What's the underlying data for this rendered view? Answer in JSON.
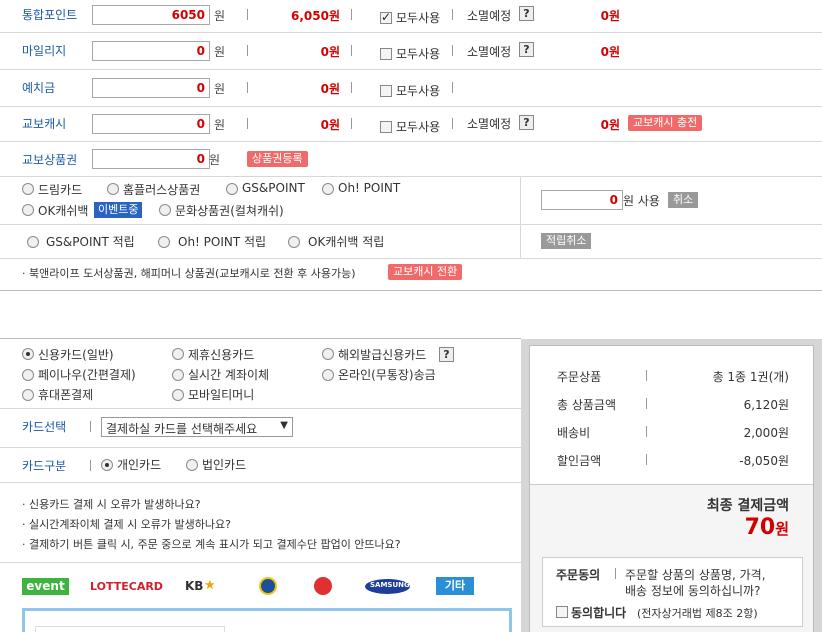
{
  "points": {
    "integrated": {
      "label": "통합포인트",
      "input": "6050",
      "won": "원",
      "available": "6,050원",
      "use_all": "모두사용",
      "use_all_checked": true,
      "expiry_label": "소멸예정",
      "expiry_value": "0원"
    },
    "mileage": {
      "label": "마일리지",
      "input": "0",
      "won": "원",
      "available": "0원",
      "use_all": "모두사용",
      "use_all_checked": false,
      "expiry_label": "소멸예정",
      "expiry_value": "0원"
    },
    "deposit": {
      "label": "예치금",
      "input": "0",
      "won": "원",
      "available": "0원",
      "use_all": "모두사용",
      "use_all_checked": false
    },
    "kyobo_cash": {
      "label": "교보캐시",
      "input": "0",
      "won": "원",
      "available": "0원",
      "use_all": "모두사용",
      "use_all_checked": false,
      "expiry_label": "소멸예정",
      "expiry_value": "0원",
      "charge_btn": "교보캐시 충전"
    },
    "gift_cert": {
      "label": "교보상품권",
      "input": "0",
      "won": "원",
      "register_btn": "상품권등록"
    }
  },
  "other_points": {
    "options": [
      "드림카드",
      "홈플러스상품권",
      "GS&POINT",
      "Oh! POINT",
      "OK캐쉬백",
      "문화상품권(컬쳐캐쉬)"
    ],
    "event_badge": "이벤트중",
    "input": "0",
    "use_label": "원 사용",
    "cancel_btn": "취소"
  },
  "accumulate": {
    "options": [
      "GS&POINT 적립",
      "Oh! POINT 적립",
      "OK캐쉬백 적립"
    ],
    "cancel_btn": "적립취소"
  },
  "notice": {
    "text": "· 북앤라이프 도서상품권, 해피머니 상품권(교보캐시로 전환 후 사용가능)",
    "convert_btn": "교보캐시 전환"
  },
  "payment": {
    "methods": [
      "신용카드(일반)",
      "제휴신용카드",
      "해외발급신용카드",
      "페이나우(간편결제)",
      "실시간 계좌이체",
      "온라인(무통장)송금",
      "휴대폰결제",
      "모바일티머니"
    ],
    "selected": "신용카드(일반)",
    "card_select_label": "카드선택",
    "card_select_value": "결제하실 카드를 선택해주세요",
    "card_type_label": "카드구분",
    "card_types": [
      "개인카드",
      "법인카드"
    ],
    "card_type_selected": "개인카드",
    "faq": [
      "· 신용카드 결제 시 오류가 발생하나요?",
      "· 실시간계좌이체 결제 시 오류가 발생하나요?",
      "· 결제하기 버튼 클릭 시, 주문 중으로 계속 표시가 되고 결제수단 팝업이 안뜨나요?"
    ],
    "card_logos": [
      "event",
      "LOTTECARD",
      "KB",
      "SAMSUNG",
      "기타"
    ]
  },
  "summary": {
    "rows": [
      {
        "label": "주문상품",
        "value": "총 1종 1권(개)"
      },
      {
        "label": "총 상품금액",
        "value": "6,120원"
      },
      {
        "label": "배송비",
        "value": "2,000원"
      },
      {
        "label": "할인금액",
        "value": "-8,050원"
      }
    ],
    "final_label": "최종 결제금액",
    "final_amount": "70",
    "final_unit": "원",
    "agree_title": "주문동의",
    "agree_text1": "주문할 상품의 상품명, 가격,",
    "agree_text2": "배송 정보에 동의하십니까?",
    "agree_check": "동의합니다",
    "agree_law": "(전자상거래법 제8조 2항)"
  },
  "colors": {
    "accent_red": "#d40000",
    "label_blue": "#1a5aa6",
    "pink_button": "#f06a6a"
  }
}
